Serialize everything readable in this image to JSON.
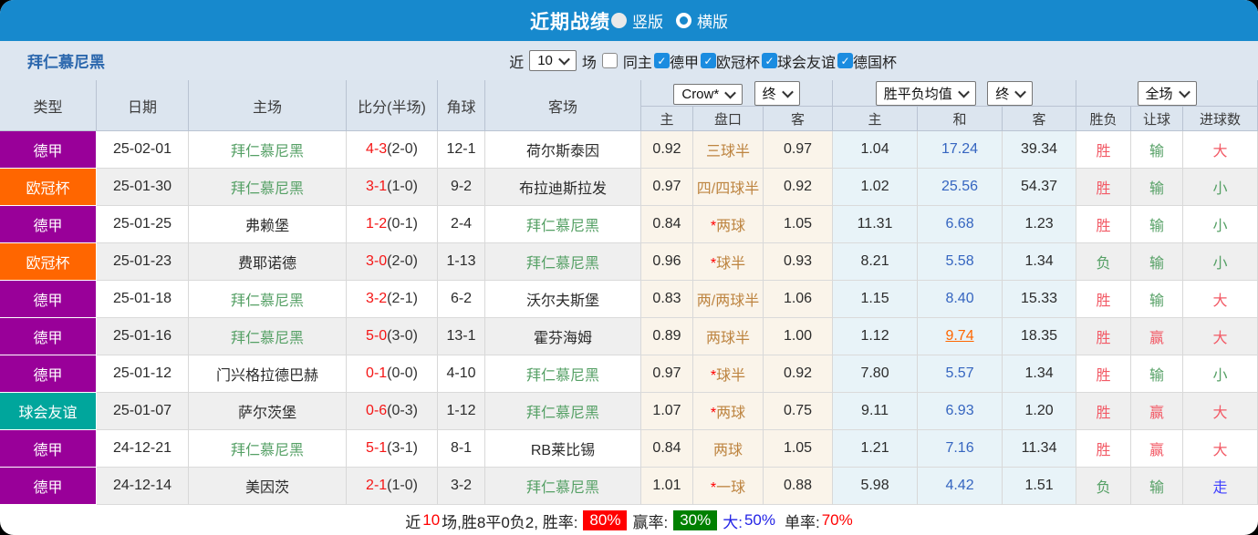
{
  "topbar": {
    "title": "近期战绩",
    "radio_vertical": "竖版",
    "radio_horizontal": "横版"
  },
  "filterbar": {
    "team": "拜仁慕尼黑",
    "recent_label": "近",
    "recent_value": "10",
    "matches_label": "场",
    "same_home_label": "同主",
    "leagues": [
      "德甲",
      "欧冠杯",
      "球会友谊",
      "德国杯"
    ]
  },
  "table": {
    "col_headers_left": [
      "类型",
      "日期",
      "主场",
      "比分(半场)",
      "角球",
      "客场"
    ],
    "dropdowns": [
      "Crow*",
      "终",
      "胜平负均值",
      "终",
      "全场"
    ],
    "sub_headers": [
      "主",
      "盘口",
      "客",
      "主",
      "和",
      "客",
      "胜负",
      "让球",
      "进球数"
    ],
    "league_colors": {
      "德甲": "#990099",
      "欧冠杯": "#ff6600",
      "球会友谊": "#00a69c"
    },
    "value_colors": {
      "胜": "red",
      "负": "green",
      "赢": "red",
      "输": "green",
      "大": "red",
      "小": "green",
      "走": "blue"
    },
    "rows": [
      {
        "type": "德甲",
        "date": "25-02-01",
        "home": "拜仁慕尼黑",
        "score": "4-3",
        "half": "(2-0)",
        "corners": "12-1",
        "away": "荷尔斯泰因",
        "odds_home": "0.92",
        "handicap": "三球半",
        "star": false,
        "odds_away": "0.97",
        "avg_win": "1.04",
        "avg_draw": "17.24",
        "avg_lose": "39.34",
        "draw_hl": false,
        "result": "胜",
        "handicap_result": "输",
        "goals": "大"
      },
      {
        "type": "欧冠杯",
        "date": "25-01-30",
        "home": "拜仁慕尼黑",
        "score": "3-1",
        "half": "(1-0)",
        "corners": "9-2",
        "away": "布拉迪斯拉发",
        "odds_home": "0.97",
        "handicap": "四/四球半",
        "star": false,
        "odds_away": "0.92",
        "avg_win": "1.02",
        "avg_draw": "25.56",
        "avg_lose": "54.37",
        "draw_hl": false,
        "result": "胜",
        "handicap_result": "输",
        "goals": "小"
      },
      {
        "type": "德甲",
        "date": "25-01-25",
        "home": "弗赖堡",
        "score": "1-2",
        "half": "(0-1)",
        "corners": "2-4",
        "away": "拜仁慕尼黑",
        "odds_home": "0.84",
        "handicap": "两球",
        "star": true,
        "odds_away": "1.05",
        "avg_win": "11.31",
        "avg_draw": "6.68",
        "avg_lose": "1.23",
        "draw_hl": false,
        "result": "胜",
        "handicap_result": "输",
        "goals": "小"
      },
      {
        "type": "欧冠杯",
        "date": "25-01-23",
        "home": "费耶诺德",
        "score": "3-0",
        "half": "(2-0)",
        "corners": "1-13",
        "away": "拜仁慕尼黑",
        "odds_home": "0.96",
        "handicap": "球半",
        "star": true,
        "odds_away": "0.93",
        "avg_win": "8.21",
        "avg_draw": "5.58",
        "avg_lose": "1.34",
        "draw_hl": false,
        "result": "负",
        "handicap_result": "输",
        "goals": "小"
      },
      {
        "type": "德甲",
        "date": "25-01-18",
        "home": "拜仁慕尼黑",
        "score": "3-2",
        "half": "(2-1)",
        "corners": "6-2",
        "away": "沃尔夫斯堡",
        "odds_home": "0.83",
        "handicap": "两/两球半",
        "star": false,
        "odds_away": "1.06",
        "avg_win": "1.15",
        "avg_draw": "8.40",
        "avg_lose": "15.33",
        "draw_hl": false,
        "result": "胜",
        "handicap_result": "输",
        "goals": "大"
      },
      {
        "type": "德甲",
        "date": "25-01-16",
        "home": "拜仁慕尼黑",
        "score": "5-0",
        "half": "(3-0)",
        "corners": "13-1",
        "away": "霍芬海姆",
        "odds_home": "0.89",
        "handicap": "两球半",
        "star": false,
        "odds_away": "1.00",
        "avg_win": "1.12",
        "avg_draw": "9.74",
        "avg_lose": "18.35",
        "draw_hl": true,
        "result": "胜",
        "handicap_result": "赢",
        "goals": "大"
      },
      {
        "type": "德甲",
        "date": "25-01-12",
        "home": "门兴格拉德巴赫",
        "score": "0-1",
        "half": "(0-0)",
        "corners": "4-10",
        "away": "拜仁慕尼黑",
        "odds_home": "0.97",
        "handicap": "球半",
        "star": true,
        "odds_away": "0.92",
        "avg_win": "7.80",
        "avg_draw": "5.57",
        "avg_lose": "1.34",
        "draw_hl": false,
        "result": "胜",
        "handicap_result": "输",
        "goals": "小"
      },
      {
        "type": "球会友谊",
        "date": "25-01-07",
        "home": "萨尔茨堡",
        "score": "0-6",
        "half": "(0-3)",
        "corners": "1-12",
        "away": "拜仁慕尼黑",
        "odds_home": "1.07",
        "handicap": "两球",
        "star": true,
        "odds_away": "0.75",
        "avg_win": "9.11",
        "avg_draw": "6.93",
        "avg_lose": "1.20",
        "draw_hl": false,
        "result": "胜",
        "handicap_result": "赢",
        "goals": "大"
      },
      {
        "type": "德甲",
        "date": "24-12-21",
        "home": "拜仁慕尼黑",
        "score": "5-1",
        "half": "(3-1)",
        "corners": "8-1",
        "away": "RB莱比锡",
        "odds_home": "0.84",
        "handicap": "两球",
        "star": false,
        "odds_away": "1.05",
        "avg_win": "1.21",
        "avg_draw": "7.16",
        "avg_lose": "11.34",
        "draw_hl": false,
        "result": "胜",
        "handicap_result": "赢",
        "goals": "大"
      },
      {
        "type": "德甲",
        "date": "24-12-14",
        "home": "美因茨",
        "score": "2-1",
        "half": "(1-0)",
        "corners": "3-2",
        "away": "拜仁慕尼黑",
        "odds_home": "1.01",
        "handicap": "一球",
        "star": true,
        "odds_away": "0.88",
        "avg_win": "5.98",
        "avg_draw": "4.42",
        "avg_lose": "1.51",
        "draw_hl": false,
        "result": "负",
        "handicap_result": "输",
        "goals": "走"
      }
    ]
  },
  "summary": {
    "lead": "近",
    "count": "10",
    "detail": "场,胜8平0负2, 胜率:",
    "win_badge": "80%",
    "draw_label": "赢率:",
    "draw_badge": "30%",
    "big_label": "大:",
    "big_value": "50%",
    "single_label": "单率:",
    "single_value": "70%"
  }
}
